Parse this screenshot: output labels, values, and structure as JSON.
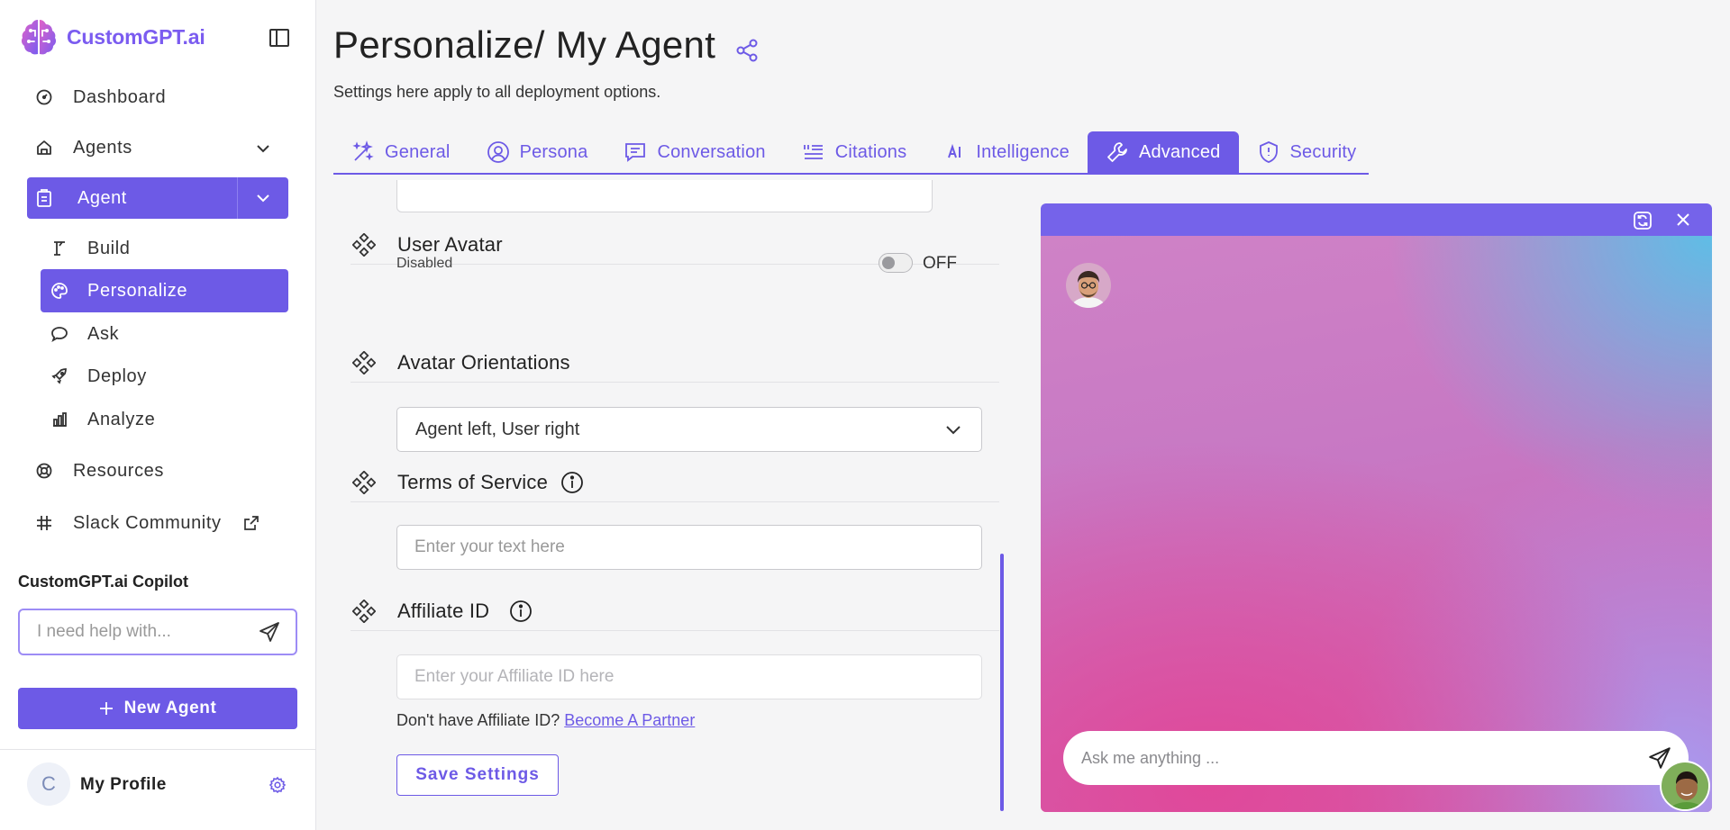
{
  "brand": {
    "name": "CustomGPT.ai",
    "accent": "#6d5ae6"
  },
  "sidebar": {
    "nav": [
      {
        "label": "Dashboard",
        "icon": "dashboard-icon"
      },
      {
        "label": "Agents",
        "icon": "home-icon"
      }
    ],
    "agent_section": {
      "label": "Agent",
      "items": [
        {
          "label": "Build",
          "icon": "build-icon"
        },
        {
          "label": "Personalize",
          "icon": "palette-icon",
          "active": true
        },
        {
          "label": "Ask",
          "icon": "chat-bubble-icon"
        },
        {
          "label": "Deploy",
          "icon": "rocket-icon"
        },
        {
          "label": "Analyze",
          "icon": "bar-chart-icon"
        }
      ]
    },
    "links": [
      {
        "label": "Resources",
        "icon": "lifebuoy-icon"
      },
      {
        "label": "Slack Community",
        "icon": "slack-icon"
      }
    ],
    "copilot": {
      "title": "CustomGPT.ai Copilot",
      "placeholder": "I need help with..."
    },
    "new_agent_label": "New Agent",
    "profile": {
      "initial": "C",
      "name": "My Profile"
    }
  },
  "header": {
    "title": "Personalize/ My Agent",
    "subtitle": "Settings here apply to all deployment options."
  },
  "tabs": [
    {
      "label": "General",
      "icon": "wand-icon"
    },
    {
      "label": "Persona",
      "icon": "user-circle-icon"
    },
    {
      "label": "Conversation",
      "icon": "message-icon"
    },
    {
      "label": "Citations",
      "icon": "quote-list-icon"
    },
    {
      "label": "Intelligence",
      "icon": "ai-icon"
    },
    {
      "label": "Advanced",
      "icon": "wrench-icon",
      "active": true
    },
    {
      "label": "Security",
      "icon": "shield-icon"
    }
  ],
  "settings": {
    "user_avatar": {
      "title": "User Avatar",
      "status_label": "Disabled",
      "toggle_state": "OFF",
      "enabled": false
    },
    "avatar_orientations": {
      "title": "Avatar Orientations",
      "selected": "Agent left, User right"
    },
    "terms_of_service": {
      "title": "Terms of Service",
      "placeholder": "Enter your text here"
    },
    "affiliate_id": {
      "title": "Affiliate ID",
      "placeholder": "Enter your Affiliate ID here",
      "prompt": "Don't have Affiliate ID?",
      "link_label": "Become A Partner"
    },
    "save_label": "Save Settings"
  },
  "preview": {
    "input_placeholder": "Ask me anything ..."
  }
}
